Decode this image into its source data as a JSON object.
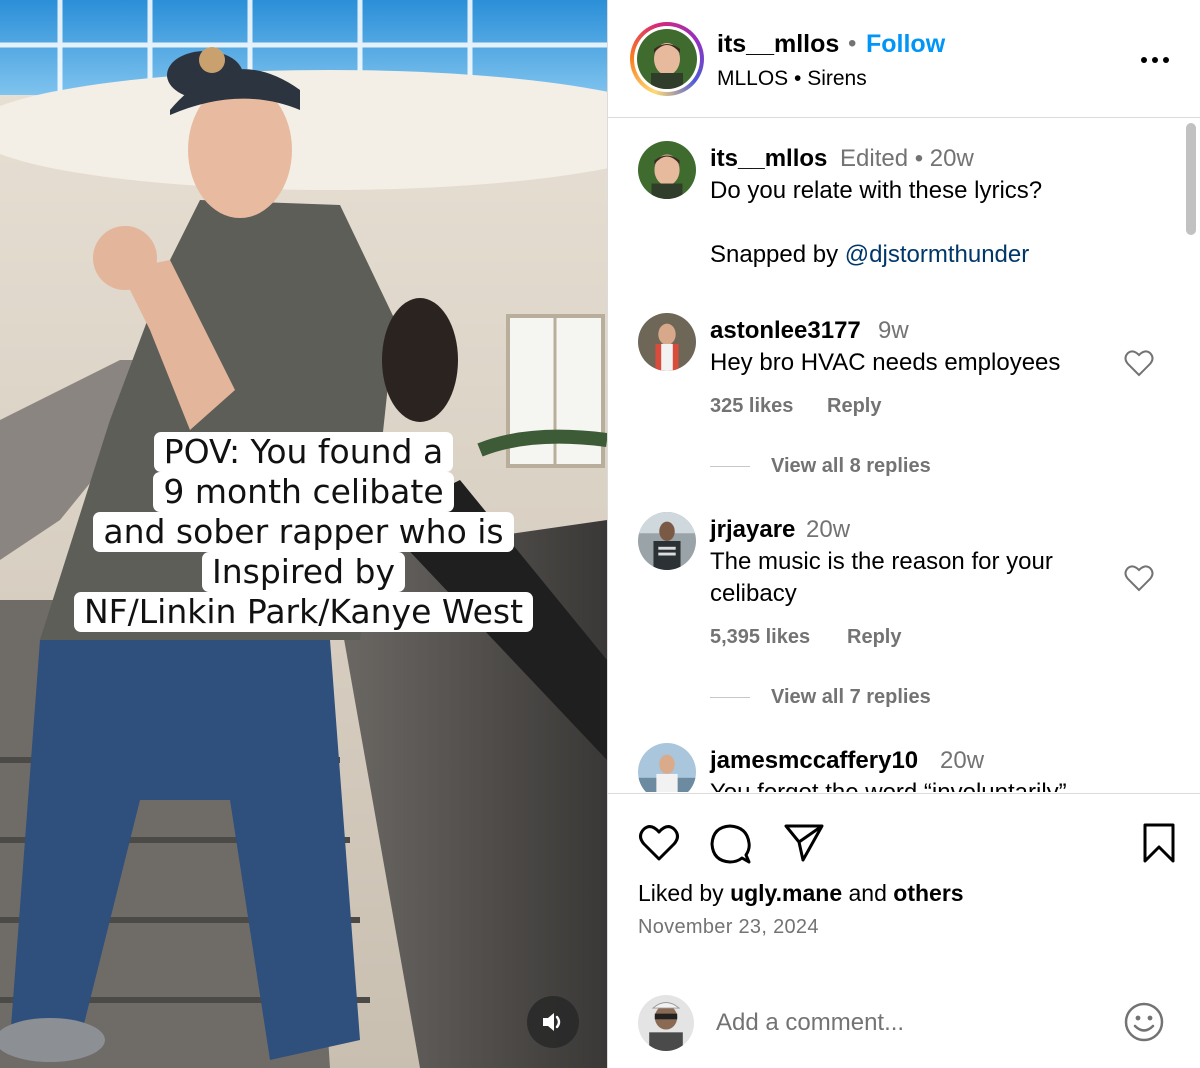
{
  "media": {
    "overlay_lines": [
      "POV: You found a",
      "9 month celibate",
      "and sober rapper who is",
      "Inspired by",
      "NF/Linkin Park/Kanye West"
    ],
    "volume_icon": "speaker-icon"
  },
  "header": {
    "username": "its__mllos",
    "separator": "•",
    "follow_label": "Follow",
    "subtitle": "MLLOS • Sirens",
    "more_icon": "more-icon"
  },
  "caption": {
    "username": "its__mllos",
    "meta": "Edited •  20w",
    "text": "Do you relate with these lyrics?",
    "credit_prefix": "Snapped by ",
    "credit_mention": "@djstormthunder"
  },
  "comments": [
    {
      "username": "astonlee3177",
      "age": "9w",
      "text": "Hey bro HVAC needs employees",
      "likes": "325 likes",
      "reply_label": "Reply",
      "view_replies": "View all 8 replies"
    },
    {
      "username": "jrjayare",
      "age": "20w",
      "text": "The music is the reason for your celibacy",
      "likes": "5,395 likes",
      "reply_label": "Reply",
      "view_replies": "View all 7 replies"
    },
    {
      "username": "jamesmccaffery10",
      "age": "20w",
      "text": "You forgot the word “involuntarily”"
    }
  ],
  "actions": {
    "liked_prefix": "Liked by ",
    "liked_user": "ugly.mane",
    "liked_and": " and ",
    "liked_others": "others",
    "date": "November 23, 2024"
  },
  "add_comment": {
    "placeholder": "Add a comment..."
  },
  "colors": {
    "follow_blue": "#0095f6",
    "mention_blue": "#00376b",
    "muted": "#737373",
    "divider": "#dbdbdb"
  }
}
